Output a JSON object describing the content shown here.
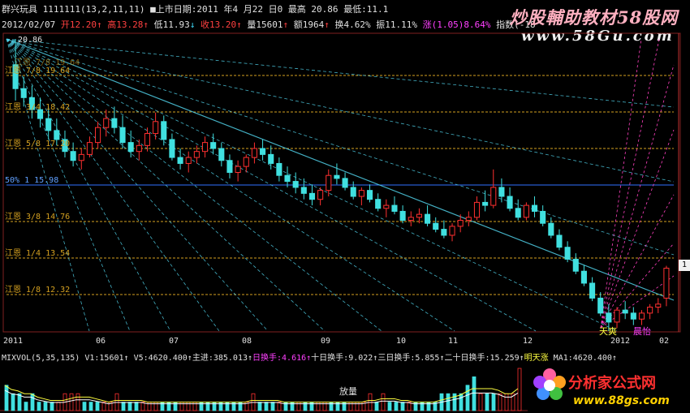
{
  "header": {
    "stock_name": "群兴玩具",
    "params": "1111111(13,2,11,11)",
    "list_date_label": "■上市日期:2011 年4 月22 日0",
    "high_label": "最高 20.86",
    "low_label": "最低:11.1",
    "high_marker": "20.86"
  },
  "quote": {
    "date": "2012/02/07",
    "open": "开12.20",
    "high": "高13.28",
    "low": "低11.93",
    "close": "收13.20",
    "volume": "量15601",
    "amount": "额1964",
    "turnover": "换4.62%",
    "amplitude": "振11.11%",
    "change": "涨(1.05)8.64%",
    "index_label": "指数(-18"
  },
  "brand_top": {
    "cn": "炒股輔助教材58股网",
    "en": "www.58Gu.com"
  },
  "gann_labels": [
    {
      "prefix": "江恩",
      "ratio": "7/8",
      "value": "19.64"
    },
    {
      "prefix": "江恩",
      "ratio": "3/4",
      "value": "18.42"
    },
    {
      "prefix": "江恩",
      "ratio": "5/8",
      "value": "17.20"
    },
    {
      "prefix": "50%",
      "ratio": "1",
      "value": "15.98"
    },
    {
      "prefix": "江恩",
      "ratio": "3/8",
      "value": "14.76"
    },
    {
      "prefix": "江恩",
      "ratio": "1/4",
      "value": "13.54"
    },
    {
      "prefix": "江恩",
      "ratio": "1/8",
      "value": "12.32"
    }
  ],
  "top_band_label": "江恩 7/8 19.64",
  "chart_annotations": {
    "weak": "天爽",
    "strong": "晨怡",
    "right_marker": "1"
  },
  "xaxis": {
    "ticks": [
      "2011",
      "06",
      "07",
      "08",
      "09",
      "10",
      "11",
      "12",
      "2012",
      "02"
    ]
  },
  "volume": {
    "header_parts": [
      {
        "text": "MIXVOL(5,35,135)",
        "color": "wht"
      },
      {
        "text": " V1:15601↑",
        "color": "wht"
      },
      {
        "text": "V5:4620.400↑",
        "color": "wht"
      },
      {
        "text": "主进:385.013↑",
        "color": "wht"
      },
      {
        "text": "日换手:4.616↑",
        "color": "mag"
      },
      {
        "text": "十日换手:9.022↑",
        "color": "wht"
      },
      {
        "text": "三日换手:5.855↑",
        "color": "wht"
      },
      {
        "text": "二十日换手:15.259↑",
        "color": "wht"
      },
      {
        "text": "明天涨",
        "color": "yel"
      },
      {
        "text": " MA1:4620.400↑",
        "color": "wht"
      }
    ],
    "label": "放量"
  },
  "brand_bottom": {
    "cn": "分析家公式网",
    "en": "www.88gs.com"
  },
  "colors": {
    "up": "#ff3030",
    "down": "#40e0e0",
    "gann_line": "#d4a020",
    "fifty_line": "#3070ff",
    "fan": "#50d0e8",
    "fan_mag": "#ff40c0"
  },
  "chart_data": {
    "type": "candlestick",
    "title": "",
    "price_levels": [
      19.64,
      18.42,
      17.2,
      15.98,
      14.76,
      13.54,
      12.32
    ],
    "ylim": [
      11.1,
      20.86
    ],
    "candles": [
      [
        20.0,
        20.86,
        18.8,
        19.2
      ],
      [
        19.2,
        19.6,
        18.6,
        18.9
      ],
      [
        18.9,
        19.3,
        18.2,
        18.5
      ],
      [
        18.5,
        18.9,
        17.9,
        18.2
      ],
      [
        18.2,
        18.6,
        17.5,
        17.8
      ],
      [
        17.8,
        18.2,
        17.3,
        17.5
      ],
      [
        17.5,
        17.8,
        16.9,
        17.1
      ],
      [
        17.1,
        17.4,
        16.6,
        16.8
      ],
      [
        16.8,
        17.2,
        16.5,
        17.0
      ],
      [
        17.0,
        17.6,
        16.9,
        17.4
      ],
      [
        17.4,
        18.1,
        17.2,
        17.9
      ],
      [
        17.9,
        18.5,
        17.6,
        18.2
      ],
      [
        18.2,
        18.6,
        17.7,
        17.9
      ],
      [
        17.9,
        18.3,
        17.2,
        17.4
      ],
      [
        17.4,
        17.8,
        16.9,
        17.1
      ],
      [
        17.1,
        17.5,
        16.8,
        17.3
      ],
      [
        17.3,
        17.9,
        17.1,
        17.7
      ],
      [
        17.7,
        18.4,
        17.5,
        18.1
      ],
      [
        18.1,
        18.3,
        17.3,
        17.5
      ],
      [
        17.5,
        17.7,
        16.8,
        16.9
      ],
      [
        16.9,
        17.2,
        16.5,
        16.7
      ],
      [
        16.7,
        17.1,
        16.4,
        16.9
      ],
      [
        16.9,
        17.3,
        16.7,
        17.1
      ],
      [
        17.1,
        17.6,
        16.9,
        17.4
      ],
      [
        17.4,
        17.7,
        17.0,
        17.2
      ],
      [
        17.2,
        17.4,
        16.6,
        16.8
      ],
      [
        16.8,
        17.0,
        16.2,
        16.4
      ],
      [
        16.4,
        16.8,
        16.1,
        16.6
      ],
      [
        16.6,
        17.0,
        16.4,
        16.9
      ],
      [
        16.9,
        17.4,
        16.7,
        17.2
      ],
      [
        17.2,
        17.5,
        16.8,
        17.0
      ],
      [
        17.0,
        17.3,
        16.5,
        16.7
      ],
      [
        16.7,
        16.9,
        16.1,
        16.3
      ],
      [
        16.3,
        16.6,
        15.9,
        16.1
      ],
      [
        16.1,
        16.4,
        15.7,
        15.9
      ],
      [
        15.9,
        16.2,
        15.5,
        15.7
      ],
      [
        15.7,
        16.0,
        15.3,
        15.5
      ],
      [
        15.5,
        15.9,
        15.3,
        15.8
      ],
      [
        15.8,
        16.5,
        15.6,
        16.3
      ],
      [
        16.3,
        16.7,
        16.0,
        16.2
      ],
      [
        16.2,
        16.4,
        15.8,
        15.9
      ],
      [
        15.9,
        16.1,
        15.5,
        15.6
      ],
      [
        15.6,
        15.9,
        15.3,
        15.8
      ],
      [
        15.8,
        16.0,
        15.4,
        15.5
      ],
      [
        15.5,
        15.7,
        15.1,
        15.2
      ],
      [
        15.2,
        15.5,
        14.9,
        15.3
      ],
      [
        15.3,
        15.6,
        15.0,
        15.1
      ],
      [
        15.1,
        15.3,
        14.7,
        14.8
      ],
      [
        14.8,
        15.1,
        14.6,
        14.9
      ],
      [
        14.9,
        15.2,
        14.7,
        15.0
      ],
      [
        15.0,
        15.3,
        14.6,
        14.7
      ],
      [
        14.7,
        14.9,
        14.4,
        14.5
      ],
      [
        14.5,
        14.8,
        14.2,
        14.3
      ],
      [
        14.3,
        14.7,
        14.1,
        14.6
      ],
      [
        14.6,
        15.0,
        14.4,
        14.8
      ],
      [
        14.8,
        15.1,
        14.6,
        14.9
      ],
      [
        14.9,
        15.6,
        14.8,
        15.4
      ],
      [
        15.4,
        15.8,
        15.1,
        15.3
      ],
      [
        15.3,
        16.5,
        15.2,
        15.9
      ],
      [
        15.9,
        16.2,
        15.4,
        15.6
      ],
      [
        15.6,
        15.9,
        15.1,
        15.2
      ],
      [
        15.2,
        15.5,
        14.8,
        14.9
      ],
      [
        14.9,
        15.4,
        14.8,
        15.3
      ],
      [
        15.3,
        15.6,
        14.9,
        15.1
      ],
      [
        15.1,
        15.3,
        14.6,
        14.7
      ],
      [
        14.7,
        14.9,
        14.2,
        14.3
      ],
      [
        14.3,
        14.5,
        13.8,
        13.9
      ],
      [
        13.9,
        14.1,
        13.4,
        13.5
      ],
      [
        13.5,
        13.7,
        13.0,
        13.1
      ],
      [
        13.1,
        13.3,
        12.6,
        12.7
      ],
      [
        12.7,
        12.9,
        12.1,
        12.2
      ],
      [
        12.2,
        12.4,
        11.6,
        11.7
      ],
      [
        11.7,
        12.0,
        11.1,
        11.4
      ],
      [
        11.4,
        11.9,
        11.2,
        11.8
      ],
      [
        11.8,
        12.1,
        11.5,
        11.7
      ],
      [
        11.7,
        11.9,
        11.3,
        11.5
      ],
      [
        11.5,
        11.8,
        11.3,
        11.7
      ],
      [
        11.7,
        12.0,
        11.5,
        11.9
      ],
      [
        11.9,
        12.2,
        11.7,
        12.0
      ],
      [
        12.2,
        13.28,
        11.93,
        13.2
      ]
    ],
    "volumes": [
      3,
      2,
      2,
      1,
      2,
      1,
      1,
      1,
      1,
      2,
      2,
      2,
      1,
      1,
      1,
      1,
      1,
      2,
      1,
      1,
      1,
      1,
      1,
      1,
      1,
      1,
      1,
      1,
      1,
      1,
      1,
      1,
      1,
      1,
      1,
      1,
      1,
      1,
      2,
      1,
      1,
      1,
      1,
      1,
      1,
      1,
      1,
      1,
      1,
      1,
      1,
      1,
      1,
      1,
      1,
      1,
      2,
      1,
      2,
      1,
      1,
      1,
      1,
      1,
      1,
      1,
      1,
      2,
      2,
      2,
      2,
      3,
      4,
      2,
      2,
      2,
      2,
      2,
      2,
      5
    ]
  }
}
